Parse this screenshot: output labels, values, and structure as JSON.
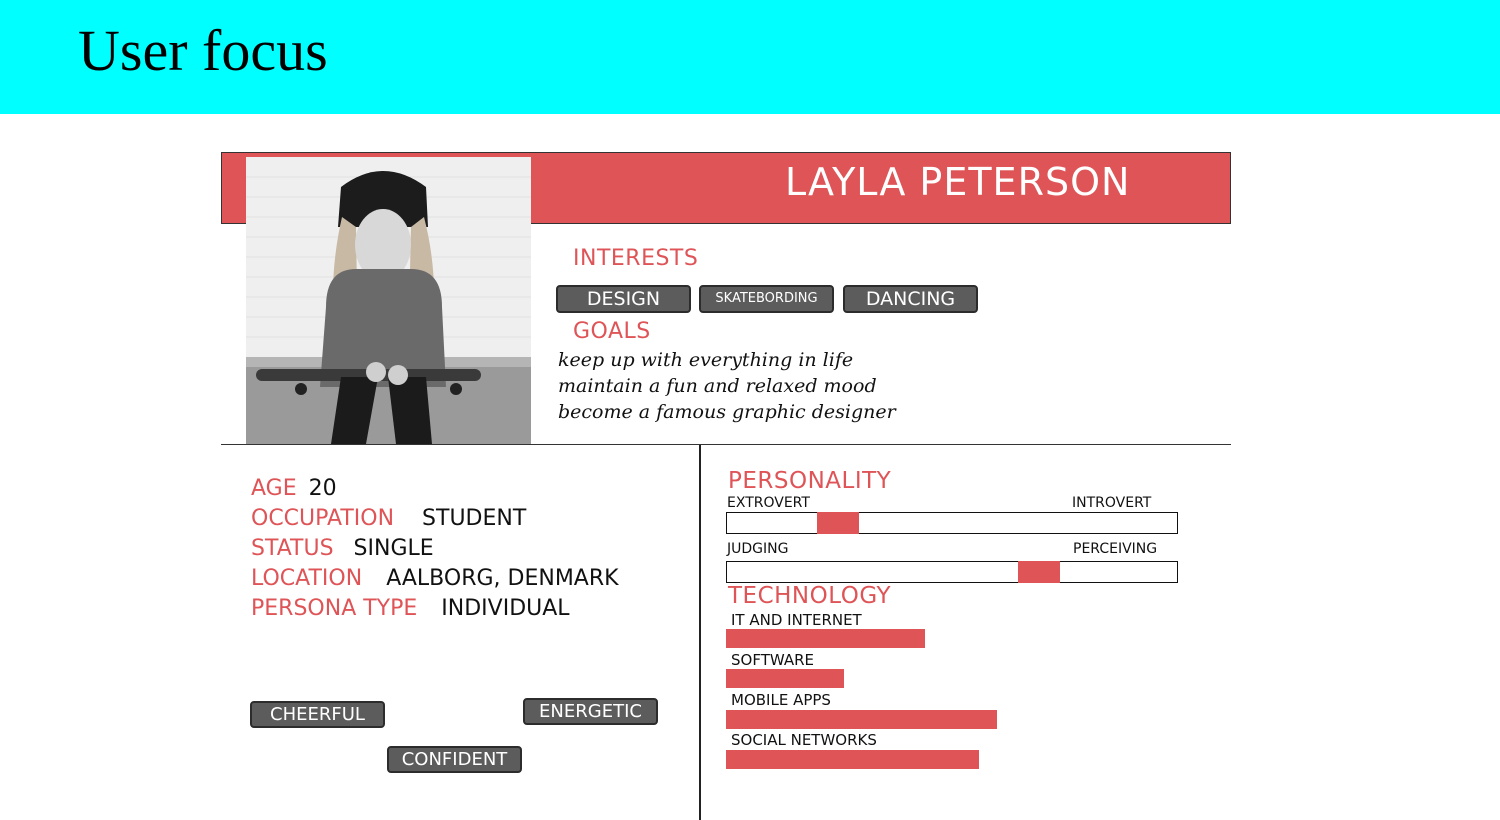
{
  "slide": {
    "title": "User focus"
  },
  "persona": {
    "name": "LAYLA PETERSON",
    "interests_label": "INTERESTS",
    "interests": [
      "DESIGN",
      "SKATEBORDING",
      "DANCING"
    ],
    "goals_label": "GOALS",
    "goals": [
      "keep up with everything in life",
      "maintain a fun and relaxed mood",
      "become a famous graphic designer"
    ],
    "info": [
      {
        "key": "AGE",
        "value": "20"
      },
      {
        "key": "OCCUPATION",
        "value": "STUDENT"
      },
      {
        "key": "STATUS",
        "value": "SINGLE"
      },
      {
        "key": "LOCATION",
        "value": "AALBORG, DENMARK"
      },
      {
        "key": "PERSONA TYPE",
        "value": "INDIVIDUAL"
      }
    ],
    "traits": [
      "CHEERFUL",
      "ENERGETIC",
      "CONFIDENT"
    ],
    "personality_label": "PERSONALITY",
    "personality": [
      {
        "left": "EXTROVERT",
        "right": "INTROVERT",
        "value": 0.22
      },
      {
        "left": "JUDGING",
        "right": "PERCEIVING",
        "value": 0.71
      }
    ],
    "technology_label": "TECHNOLOGY",
    "technology": [
      {
        "label": "IT AND INTERNET",
        "value": 0.44
      },
      {
        "label": "SOFTWARE",
        "value": 0.26
      },
      {
        "label": "MOBILE APPS",
        "value": 0.6
      },
      {
        "label": "SOCIAL NETWORKS",
        "value": 0.56
      }
    ]
  },
  "colors": {
    "header_bg": "#00ffff",
    "accent": "#de5457",
    "pill": "#5c5c5c"
  }
}
